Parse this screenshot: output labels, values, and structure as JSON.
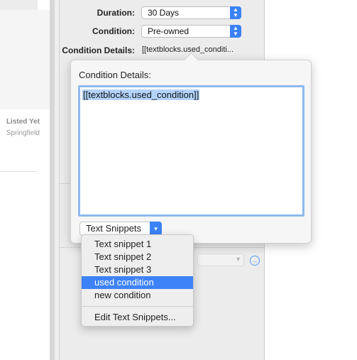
{
  "left_list": {
    "status": "Listed Yet",
    "location": "Springfield"
  },
  "form": {
    "duration_label": "Duration:",
    "duration_value": "30 Days",
    "condition_label": "Condition:",
    "condition_value": "Pre-owned",
    "condition_details_label": "Condition Details:",
    "condition_details_value": "[[textblocks.used_conditi..."
  },
  "popover": {
    "title": "Condition Details:",
    "text": "[[textblocks.used_condition]]",
    "snippets_button": "Text Snippets"
  },
  "menu": {
    "items": [
      "Text snippet 1",
      "Text snippet 2",
      "Text snippet 3",
      "used condition",
      "new condition"
    ],
    "selected_index": 3,
    "edit_label": "Edit Text Snippets..."
  },
  "colors": {
    "accent": "#3b82f6",
    "selection": "#b3d4fc",
    "focus_ring": "#8db9ee"
  }
}
